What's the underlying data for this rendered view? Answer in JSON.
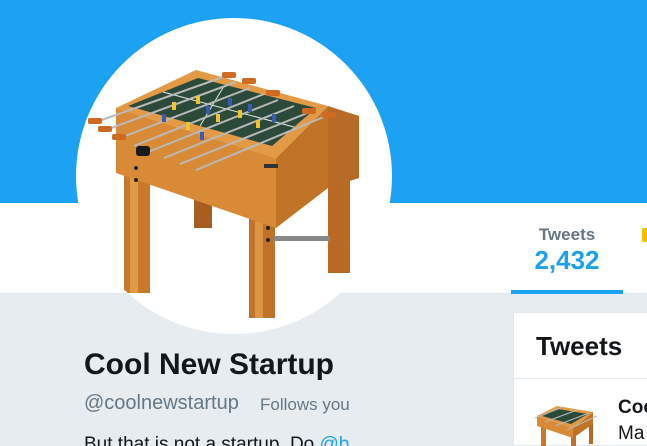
{
  "banner": {
    "color": "#1da1f2"
  },
  "profile": {
    "name": "Cool New Startup",
    "handle": "@coolnewstartup",
    "follows_you": "Follows you",
    "bio_start": "But that is not a startup. Do ",
    "bio_mention": "@b..."
  },
  "stats": {
    "tweets_label": "Tweets",
    "tweets_count": "2,432"
  },
  "tweets_panel": {
    "title": "Tweets",
    "item": {
      "author": "Coo",
      "text": "Ma"
    }
  },
  "colors": {
    "accent": "#1da1f2",
    "text": "#14171a",
    "muted": "#657786",
    "background": "#e6ecf0"
  },
  "avatar": {
    "icon": "foosball-table-image"
  }
}
